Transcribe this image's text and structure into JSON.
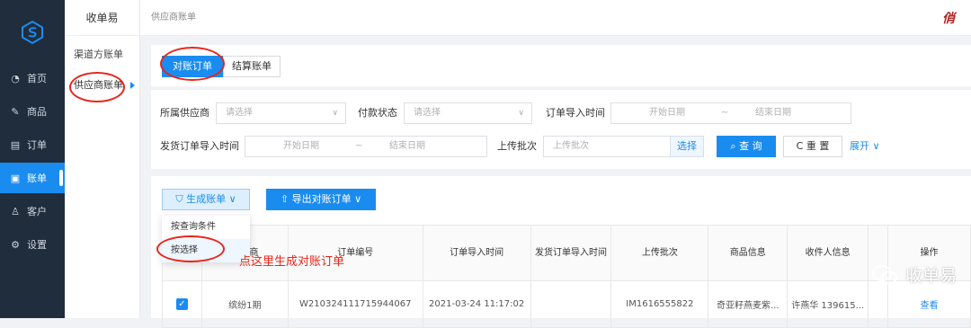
{
  "sidebar": {
    "items": [
      {
        "label": "首页",
        "icon": "gauge-icon"
      },
      {
        "label": "商品",
        "icon": "edit-icon"
      },
      {
        "label": "订单",
        "icon": "list-icon"
      },
      {
        "label": "账单",
        "icon": "clipboard-icon",
        "active": true
      },
      {
        "label": "客户",
        "icon": "user-icon"
      },
      {
        "label": "设置",
        "icon": "gear-icon"
      }
    ]
  },
  "subnav": {
    "title": "收单易",
    "items": [
      {
        "label": "渠道方账单"
      },
      {
        "label": "供应商账单",
        "active": true
      }
    ]
  },
  "breadcrumb": "供应商账单",
  "tabs": [
    "对账订单",
    "结算账单"
  ],
  "filters": {
    "supplier_label": "所属供应商",
    "supplier_placeholder": "请选择",
    "pay_status_label": "付款状态",
    "pay_status_placeholder": "请选择",
    "import_time_label": "订单导入时间",
    "start_date": "开始日期",
    "sep": "~",
    "end_date": "结束日期",
    "ship_import_label": "发货订单导入时间",
    "batch_label": "上传批次",
    "batch_placeholder": "上传批次",
    "batch_select": "选择",
    "search_button": "查 询",
    "reset_button": "重 置",
    "expand_link": "展开"
  },
  "actions": {
    "generate_bill": "生成账单",
    "export_orders": "导出对账订单",
    "dropdown": [
      "按查询条件",
      "按选择"
    ]
  },
  "annotation": "点这里生成对账订单",
  "table": {
    "columns": [
      "",
      "供应商",
      "订单编号",
      "订单导入时间",
      "发货订单导入时间",
      "上传批次",
      "商品信息",
      "收件人信息",
      "",
      "操作"
    ],
    "rows": [
      {
        "supplier": "缤纷1期",
        "order_no": "W210324111715944067",
        "import_time": "2021-03-24 11:17:02",
        "ship_time": "",
        "batch": "IM1616555822",
        "goods": "奇亚籽燕麦紫...",
        "receiver": "许燕华 139615...",
        "action": "查看"
      }
    ]
  },
  "watermark": "收单易",
  "colors": {
    "accent": "#1a8cf0",
    "sidebar": "#1f2d3d",
    "annotation": "#e8251a"
  }
}
